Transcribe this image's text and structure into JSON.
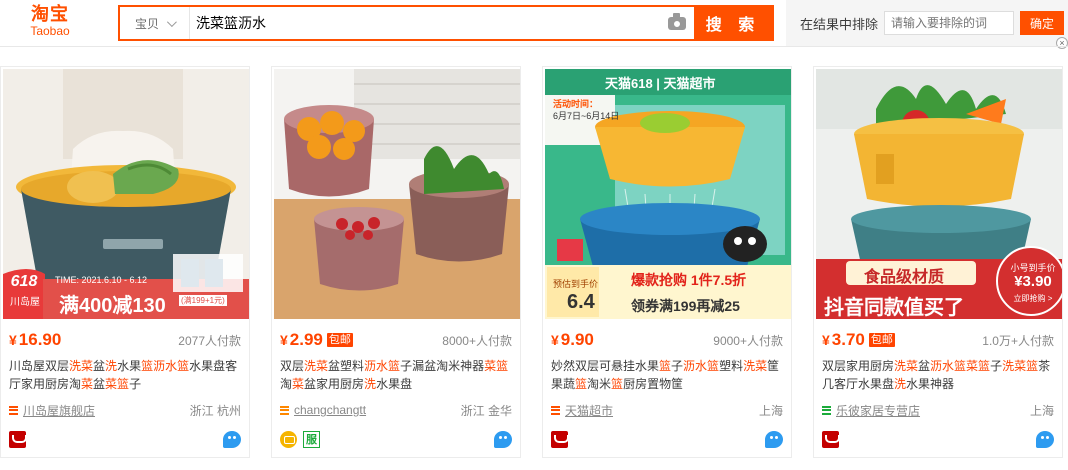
{
  "header": {
    "logo_cn": "淘宝",
    "logo_en": "Taobao",
    "scope_label": "宝贝",
    "query": "洗菜篮沥水",
    "search_button": "搜 索",
    "exclude_label": "在结果中排除",
    "exclude_placeholder": "请输入要排除的词",
    "exclude_button": "确定",
    "close_glyph": "×"
  },
  "colors": {
    "brand": "#ff5000",
    "price": "#ff4400",
    "tmall": "#c40000",
    "wangwang": "#2d9bf0"
  },
  "products": [
    {
      "image_text": {
        "badge618": "618",
        "brand_tag": "川岛屋",
        "promo": "满400减130",
        "time": "TIME: 2021.6.10 - 6.12",
        "gift": "(满199+1元)"
      },
      "price": "16.90",
      "yen": "¥",
      "baoyou": "",
      "paid": "2077人付款",
      "title_parts": [
        [
          "川岛屋双层",
          false
        ],
        [
          "洗菜",
          true
        ],
        [
          "盆",
          false
        ],
        [
          "洗",
          true
        ],
        [
          "水果",
          false
        ],
        [
          "篮沥水篮",
          true
        ],
        [
          "水果盘客厅家用厨房淘",
          false
        ],
        [
          "菜",
          true
        ],
        [
          "盆",
          false
        ],
        [
          "菜篮",
          true
        ],
        [
          "子",
          false
        ]
      ],
      "shop": "川岛屋旗舰店",
      "shop_icon_color": "#ff5000",
      "location": "浙江 杭州",
      "badges": [
        "tmall-icon"
      ]
    },
    {
      "image_text": {},
      "price": "2.99",
      "yen": "¥",
      "baoyou": "包邮",
      "paid": "8000+人付款",
      "title_parts": [
        [
          "双层",
          false
        ],
        [
          "洗菜",
          true
        ],
        [
          "盆塑料",
          false
        ],
        [
          "沥水篮",
          true
        ],
        [
          "子漏盆淘米神器",
          false
        ],
        [
          "菜篮",
          true
        ],
        [
          "淘",
          false
        ],
        [
          "菜",
          true
        ],
        [
          "盆家用厨房",
          false
        ],
        [
          "洗",
          true
        ],
        [
          "水果盘",
          false
        ]
      ],
      "shop": "changchangtt",
      "shop_icon_color": "#ff8800",
      "location": "浙江 金华",
      "badges": [
        "gold-seller-icon",
        "service-icon"
      ],
      "service_glyph": "服"
    },
    {
      "image_text": {
        "store": "天猫618 | 天猫超市",
        "event": "活动时间：",
        "dates": "6月7日~6月14日",
        "flash": "爆款抢购 1件7.5折",
        "pre_label": "预估到手价",
        "pre_price": "6.4",
        "coupon": "领券满199再减25"
      },
      "price": "9.90",
      "yen": "¥",
      "baoyou": "",
      "paid": "9000+人付款",
      "title_parts": [
        [
          "妙然双层可悬挂水果",
          false
        ],
        [
          "篮",
          true
        ],
        [
          "子",
          false
        ],
        [
          "沥水篮",
          true
        ],
        [
          "塑料",
          false
        ],
        [
          "洗菜",
          true
        ],
        [
          "筐果蔬",
          false
        ],
        [
          "篮",
          true
        ],
        [
          "淘米",
          false
        ],
        [
          "篮",
          true
        ],
        [
          "厨房置物筐",
          false
        ]
      ],
      "shop": "天猫超市",
      "shop_icon_color": "#ff5000",
      "location": "上海",
      "badges": [
        "tmall-icon"
      ]
    },
    {
      "image_text": {
        "grade": "食品级材质",
        "slogan": "抖音同款值买了",
        "bubble_top": "小号到手价",
        "bubble_price": "¥3.90",
        "bubble_cta": "立即抢购 >"
      },
      "price": "3.70",
      "yen": "¥",
      "baoyou": "包邮",
      "paid": "1.0万+人付款",
      "title_parts": [
        [
          "双层家用厨房",
          false
        ],
        [
          "洗菜",
          true
        ],
        [
          "盆",
          false
        ],
        [
          "沥水篮菜篮",
          true
        ],
        [
          "子",
          false
        ],
        [
          "洗菜篮",
          true
        ],
        [
          "茶几客厅水果盘",
          false
        ],
        [
          "洗",
          true
        ],
        [
          "水果神器",
          false
        ]
      ],
      "shop": "乐彼家居专营店",
      "shop_icon_color": "#1cab3b",
      "location": "上海",
      "badges": [
        "tmall-icon"
      ]
    }
  ]
}
